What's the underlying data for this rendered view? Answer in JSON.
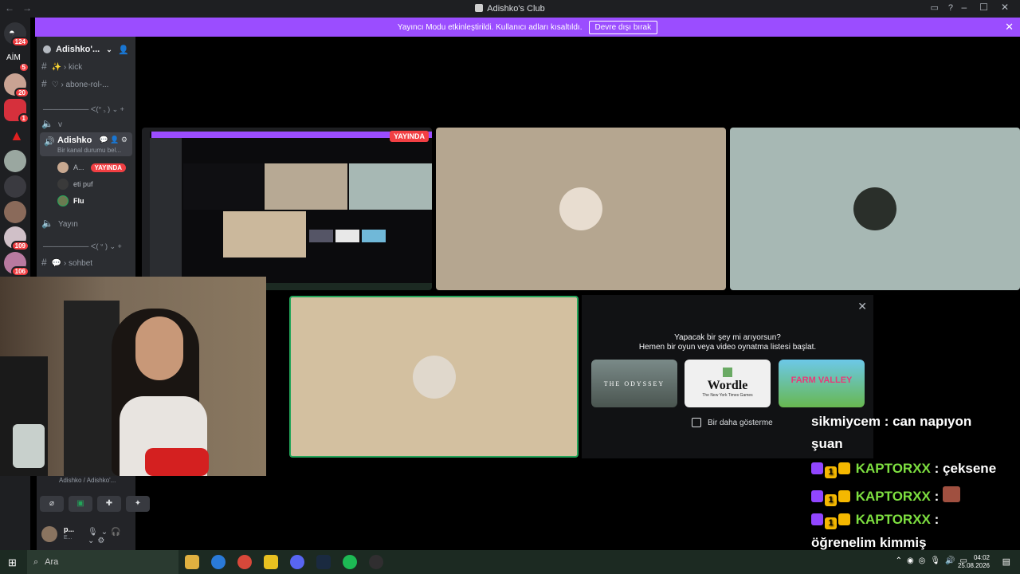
{
  "window": {
    "title": "Adishko's Club"
  },
  "banner": {
    "text": "Yayıncı Modu etkinleştirildi. Kullanıcı adları kısaltıldı.",
    "button": "Devre dışı bırak"
  },
  "guilds": {
    "badges": [
      "124",
      "5",
      "20",
      "1",
      "109",
      "106"
    ],
    "aim_label": "AİM"
  },
  "server": {
    "name": "Adishko'..."
  },
  "channels": {
    "kick": "› kick",
    "abone": "› abone-rol-...",
    "divider1": "ᐸ(ᐡ ꜆ )",
    "v": "v",
    "active_name": "Adishko",
    "active_status": "Bir kanal durumu bel...",
    "users": [
      {
        "name": "A...",
        "live": "YAYINDA"
      },
      {
        "name": "eti puf"
      },
      {
        "name": "Flu"
      }
    ],
    "yayin": "Yayın",
    "divider2": "ᐸ( ᐡ )",
    "sohbet": "› sohbet"
  },
  "voice": {
    "connection": "Adishko / Adishko'...",
    "user": "p...",
    "user_status": "E..."
  },
  "stream": {
    "live_badge": "YAYINDA"
  },
  "activity": {
    "line1": "Yapacak bir şey mi arıyorsun?",
    "line2": "Hemen bir oyun veya video oynatma listesi başlat.",
    "games": [
      "THE ODYSSEY",
      "Wordle",
      "FARM VALLEY"
    ],
    "wordle_sub": "The New York Times Games",
    "dont_show": "Bir daha gösterme"
  },
  "chat": [
    {
      "user": "sikmiycem",
      "text": "can napıyon"
    },
    {
      "text": "şuan"
    },
    {
      "user": "KAPTORXX",
      "text": "çeksene"
    },
    {
      "user": "KAPTORXX",
      "text": ""
    },
    {
      "user": "KAPTORXX",
      "text": ""
    },
    {
      "text": "öğrenelim kimmiş"
    }
  ],
  "chat_separator": ":",
  "badge_number": "1",
  "taskbar": {
    "search": "Ara",
    "time": "04:02",
    "date": "25.08.2026"
  }
}
